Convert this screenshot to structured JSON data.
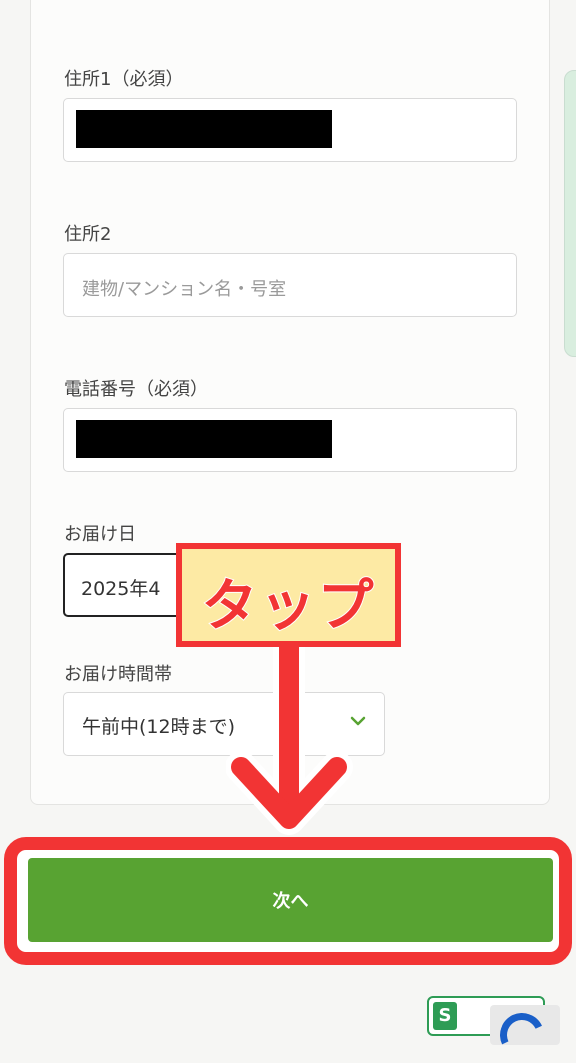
{
  "form": {
    "address1_label": "住所1（必須）",
    "address2_label": "住所2",
    "address2_placeholder": "建物/マンション名・号室",
    "phone_label": "電話番号（必須）",
    "delivery_date_label": "お届け日",
    "delivery_date_value": "2025年4",
    "delivery_time_label": "お届け時間帯",
    "delivery_time_value": "午前中(12時まで)"
  },
  "annotation": {
    "callout_text": "タップ",
    "color": "#f23434"
  },
  "actions": {
    "next_label": "次へ",
    "button_color": "#58a332"
  },
  "icons": {
    "select": "chevron-down-icon",
    "arrow": "arrow-down-icon",
    "badge": "security-badge-icon",
    "recaptcha": "recaptcha-icon"
  }
}
